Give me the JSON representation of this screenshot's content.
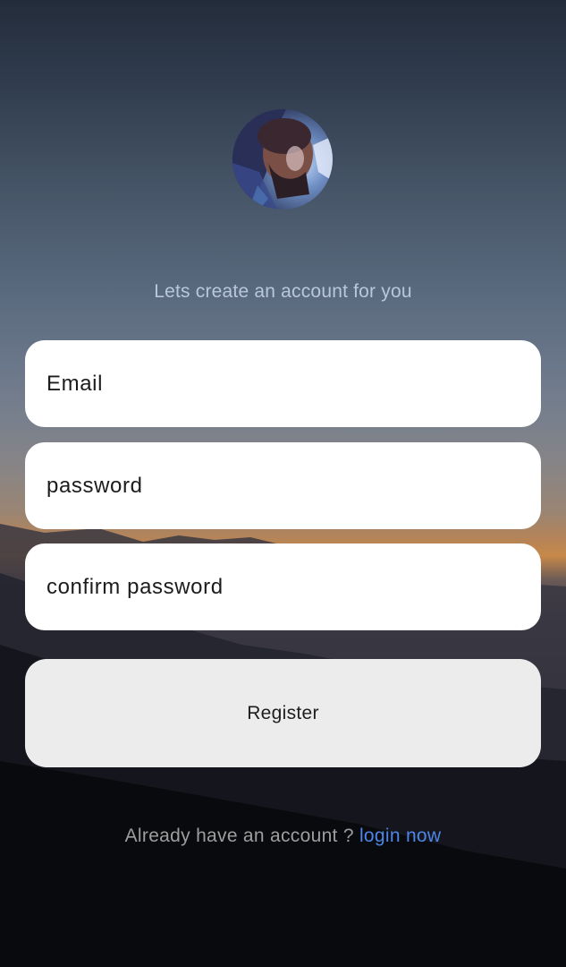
{
  "app": {
    "subtitle": "Lets create an account for you"
  },
  "form": {
    "email_placeholder": "Email",
    "password_placeholder": "password",
    "confirm_placeholder": "confirm password",
    "register_label": "Register"
  },
  "footer": {
    "prompt": "Already have an account ?",
    "link": "login now"
  },
  "theme": {
    "link_color": "#4d86e6",
    "subtitle_color": "#b9c6dd"
  },
  "icons": {
    "avatar": "profile-avatar-image"
  }
}
